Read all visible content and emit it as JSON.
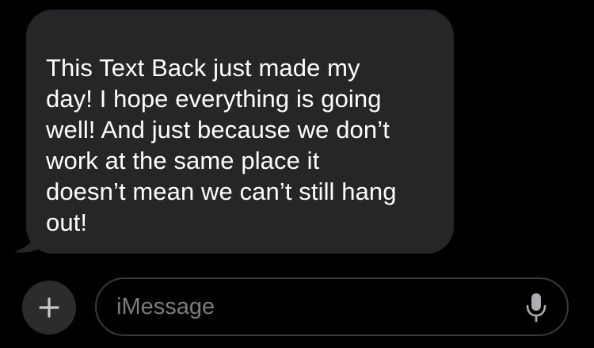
{
  "thread": {
    "message": {
      "text": "This Text Back just made my\nday! I hope everything is going\nwell! And just because we don’t\nwork at the same place it\ndoesn’t mean we can’t still hang\nout!",
      "direction": "received"
    }
  },
  "composer": {
    "add_icon": "plus-icon",
    "placeholder": "iMessage",
    "value": "",
    "dictation_icon": "microphone-icon"
  },
  "colors": {
    "background": "#000000",
    "bubble": "#262628",
    "field_border": "#3a3a3c",
    "placeholder": "#7c7c80",
    "icon": "#aeaeb2"
  }
}
